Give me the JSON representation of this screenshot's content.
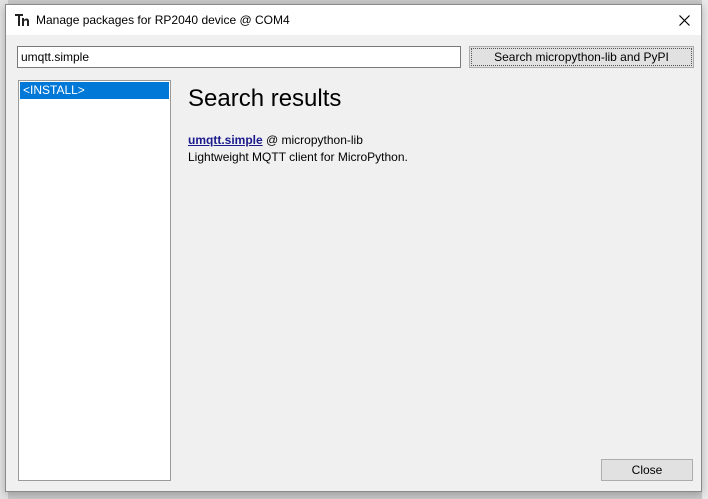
{
  "window": {
    "title": "Manage packages for RP2040 device @ COM4"
  },
  "search": {
    "value": "umqtt.simple",
    "button_label": "Search micropython-lib and PyPI"
  },
  "sidebar": {
    "items": [
      {
        "label": "<INSTALL>",
        "selected": true
      }
    ]
  },
  "main": {
    "heading": "Search results",
    "results": [
      {
        "name": "umqtt.simple",
        "source": " @ micropython-lib",
        "description": "Lightweight MQTT client for MicroPython."
      }
    ]
  },
  "footer": {
    "close_label": "Close"
  },
  "icons": {
    "app": "thonny-icon",
    "close": "close-icon"
  },
  "colors": {
    "selection": "#0078d7",
    "link": "#1a1a8c",
    "dialog_bg": "#f0f0f0"
  }
}
